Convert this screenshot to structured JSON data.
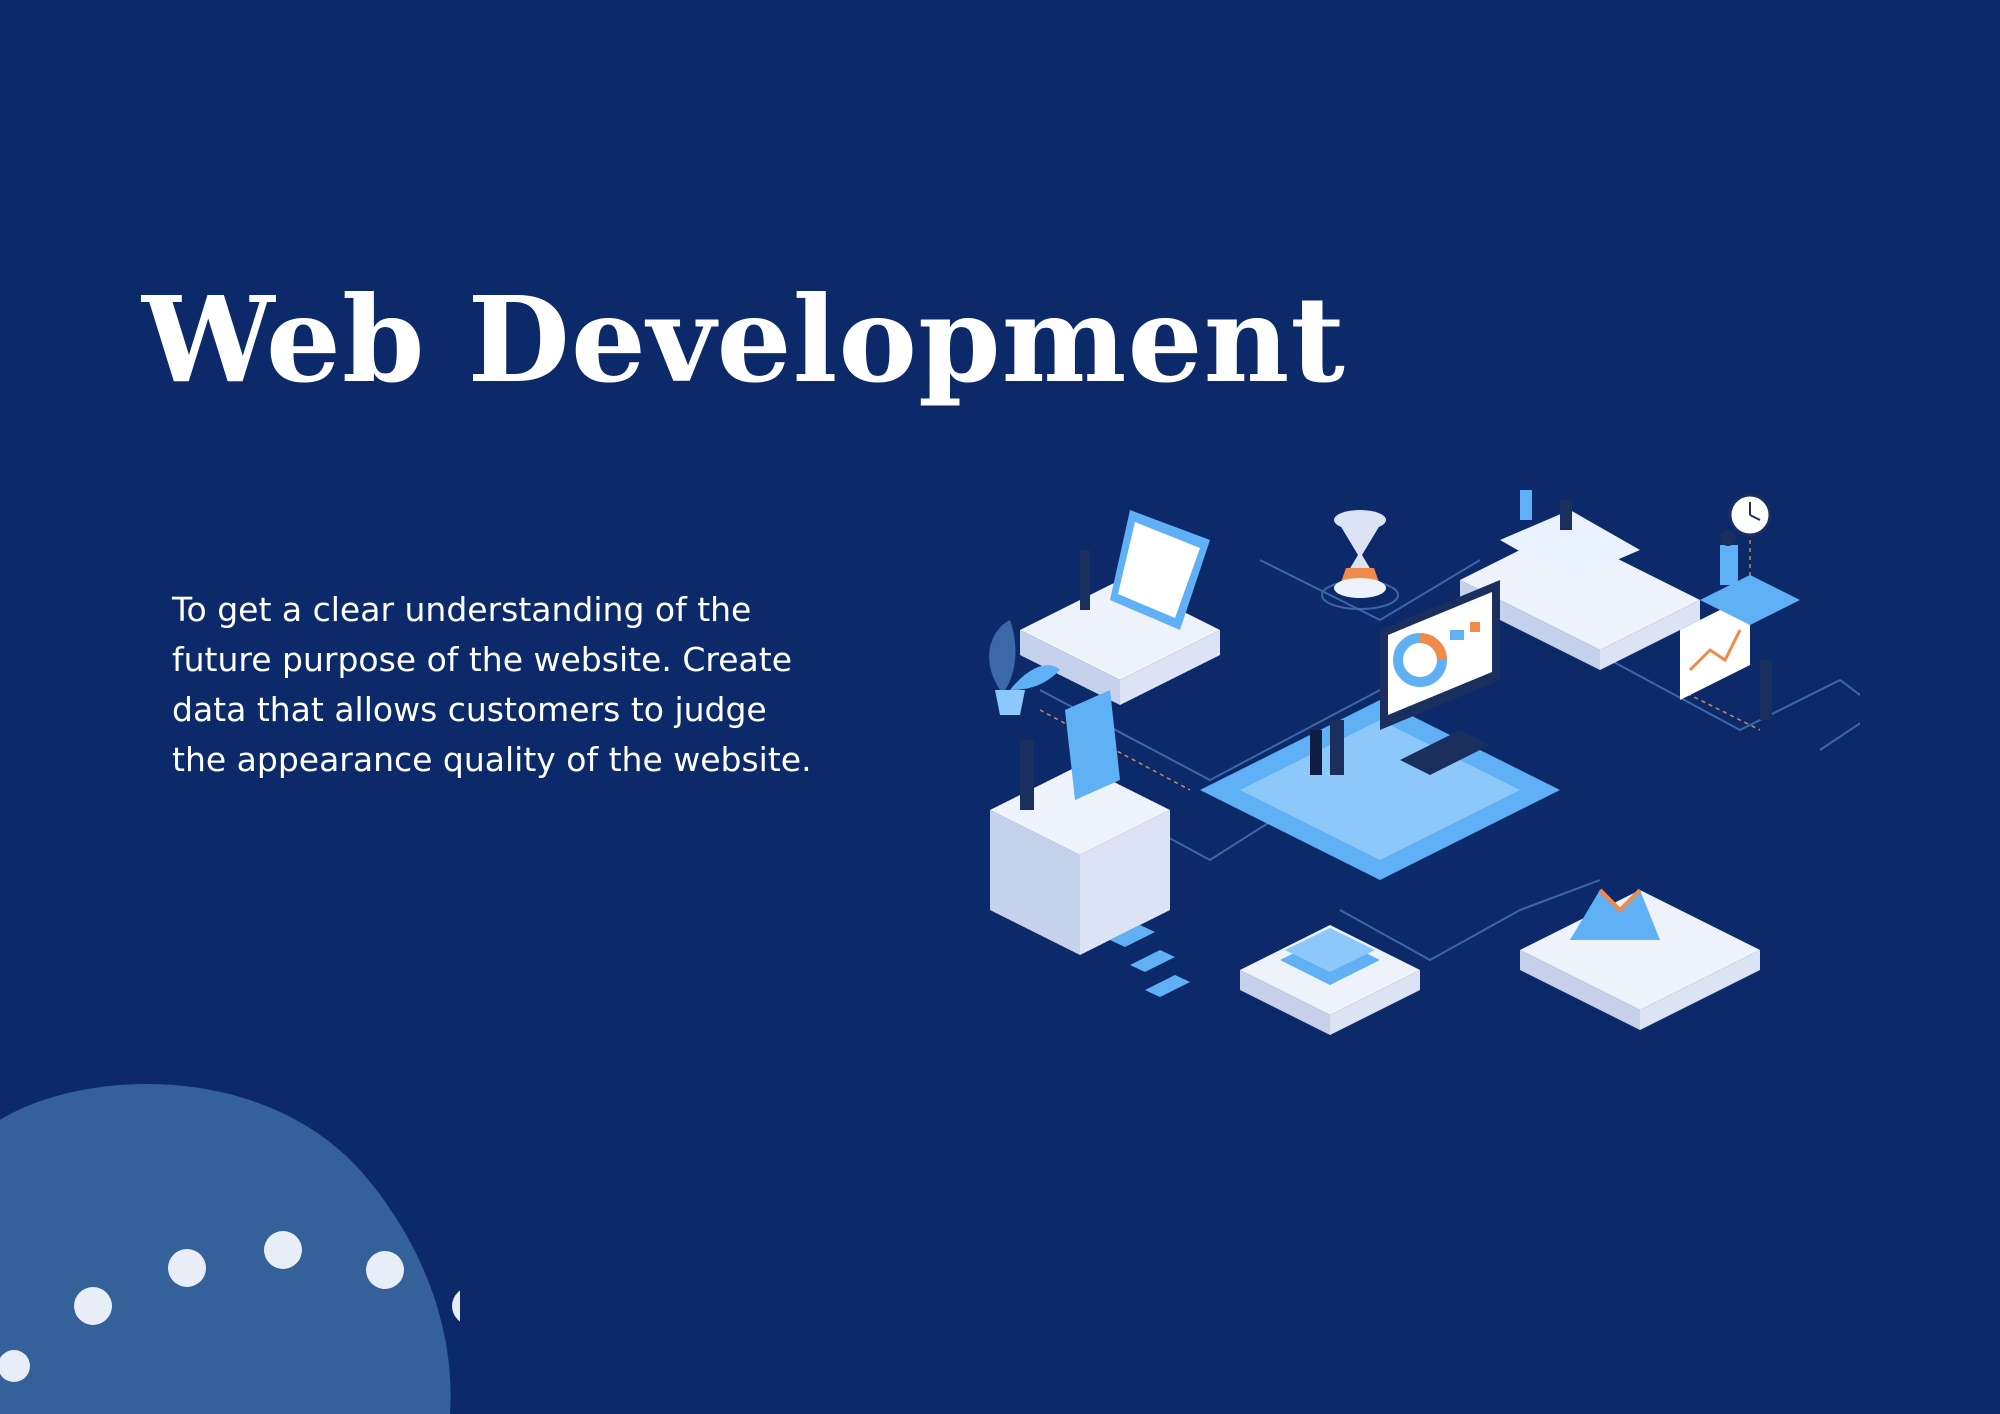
{
  "slide": {
    "title": "Web Development",
    "description_lines": [
      "To get a clear understanding of the",
      "future purpose of the website. Create",
      "data that allows customers to judge",
      "the appearance quality of the website."
    ]
  },
  "colors": {
    "background": "#0c2a6a",
    "blob": "#35619a",
    "dots": "#e8eef8",
    "accent_blue": "#5fb0f5",
    "accent_orange": "#f08a4b",
    "platform_light": "#eef2fb"
  },
  "illustration": {
    "icons": [
      "calendar-icon",
      "hourglass-icon",
      "desk-icon",
      "clock-icon",
      "monitor-dashboard-icon",
      "calculator-icon",
      "plant-icon",
      "books-icon",
      "chart-board-icon",
      "area-chart-icon",
      "laptop-person-icon"
    ]
  }
}
